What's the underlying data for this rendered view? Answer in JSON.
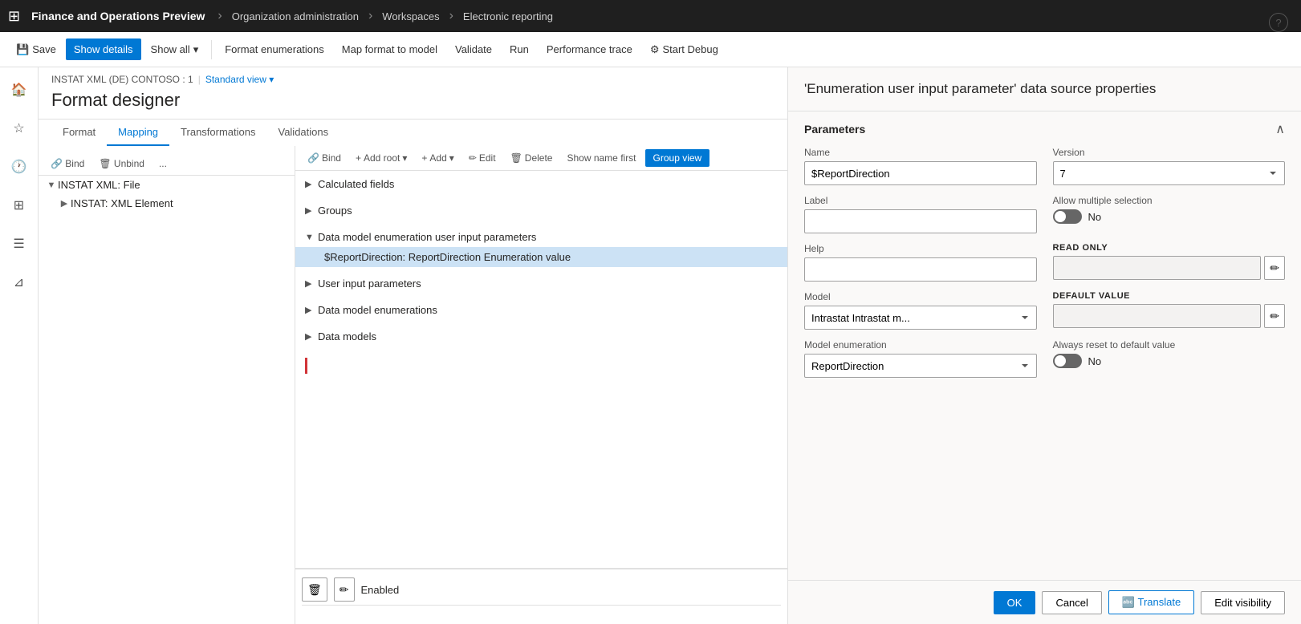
{
  "topnav": {
    "grid_icon": "⊞",
    "app_title": "Finance and Operations Preview",
    "nav_items": [
      "Organization administration",
      "Workspaces",
      "Electronic reporting"
    ]
  },
  "toolbar": {
    "save_label": "Save",
    "show_details_label": "Show details",
    "show_all_label": "Show all",
    "format_enumerations_label": "Format enumerations",
    "map_format_label": "Map format to model",
    "validate_label": "Validate",
    "run_label": "Run",
    "performance_trace_label": "Performance trace",
    "start_debug_label": "Start Debug"
  },
  "breadcrumb": {
    "item_label": "INSTAT XML (DE) CONTOSO : 1",
    "view_label": "Standard view"
  },
  "page_title": "Format designer",
  "inner_toolbar": {
    "bind_label": "Bind",
    "unbind_label": "Unbind",
    "more_label": "..."
  },
  "tabs": {
    "items": [
      "Format",
      "Mapping",
      "Transformations",
      "Validations"
    ],
    "active": "Mapping"
  },
  "tree": {
    "items": [
      {
        "label": "INSTAT XML: File",
        "level": 0,
        "expanded": true,
        "expander": "▼"
      },
      {
        "label": "INSTAT: XML Element",
        "level": 1,
        "expanded": false,
        "expander": "▶"
      }
    ]
  },
  "datasource_toolbar": {
    "bind_label": "Bind",
    "add_root_label": "Add root",
    "add_label": "Add",
    "edit_label": "Edit",
    "delete_label": "Delete",
    "show_name_first_label": "Show name first",
    "group_view_label": "Group view"
  },
  "datasource_groups": [
    {
      "label": "Calculated fields",
      "expanded": false
    },
    {
      "label": "Groups",
      "expanded": false
    },
    {
      "label": "Data model enumeration user input parameters",
      "expanded": true,
      "items": [
        "$ReportDirection: ReportDirection Enumeration value"
      ]
    },
    {
      "label": "User input parameters",
      "expanded": false
    },
    {
      "label": "Data model enumerations",
      "expanded": false
    },
    {
      "label": "Data models",
      "expanded": false
    }
  ],
  "bottom_edit": {
    "enabled_label": "Enabled"
  },
  "right_panel": {
    "title": "'Enumeration user input parameter' data source properties",
    "section_label": "Parameters",
    "fields": {
      "name_label": "Name",
      "name_value": "$ReportDirection",
      "version_label": "Version",
      "version_value": "7",
      "label_label": "Label",
      "label_value": "",
      "allow_multiple_label": "Allow multiple selection",
      "allow_multiple_value": "No",
      "help_label": "Help",
      "help_value": "",
      "read_only_label": "READ ONLY",
      "read_only_value": "",
      "model_label": "Model",
      "model_value": "Intrastat",
      "model_sub_value": "Intrastat m...",
      "default_value_label": "DEFAULT VALUE",
      "default_value_value": "",
      "model_enumeration_label": "Model enumeration",
      "model_enumeration_value": "ReportDirection",
      "always_reset_label": "Always reset to default value",
      "always_reset_value": "No"
    }
  },
  "footer_buttons": {
    "ok_label": "OK",
    "cancel_label": "Cancel",
    "translate_label": "Translate",
    "edit_visibility_label": "Edit visibility"
  }
}
